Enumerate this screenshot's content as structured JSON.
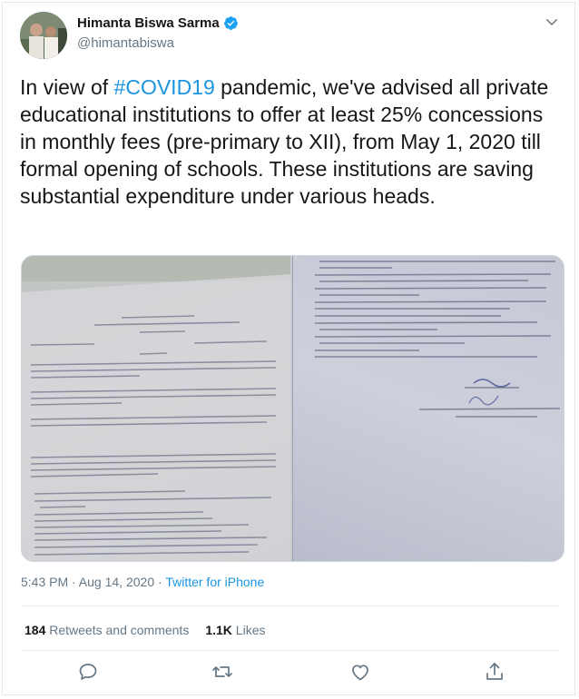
{
  "user": {
    "display_name": "Himanta Biswa Sarma",
    "handle": "@himantabiswa",
    "verified": true
  },
  "tweet": {
    "text_before": "In view of ",
    "hashtag": "#COVID19",
    "text_after": " pandemic, we've advised all private educational institutions to offer at least 25% concessions in monthly fees (pre-primary to XII), from May 1, 2020 till formal opening of schools. These institutions are saving substantial expenditure under various heads."
  },
  "meta": {
    "timestamp": "5:43 PM · Aug 14, 2020",
    "separator": " · ",
    "source": "Twitter for iPhone"
  },
  "stats": {
    "retweets_count": "184",
    "retweets_label": " Retweets and comments",
    "likes_count": "1.1K",
    "likes_label": " Likes"
  },
  "icons": {
    "caret": "chevron-down-icon",
    "verified": "verified-badge-icon",
    "reply": "reply-icon",
    "retweet": "retweet-icon",
    "like": "heart-icon",
    "share": "share-icon"
  },
  "colors": {
    "link": "#1b95e0",
    "secondary": "#657786",
    "text": "#14171a",
    "border": "#e1e8ed"
  }
}
